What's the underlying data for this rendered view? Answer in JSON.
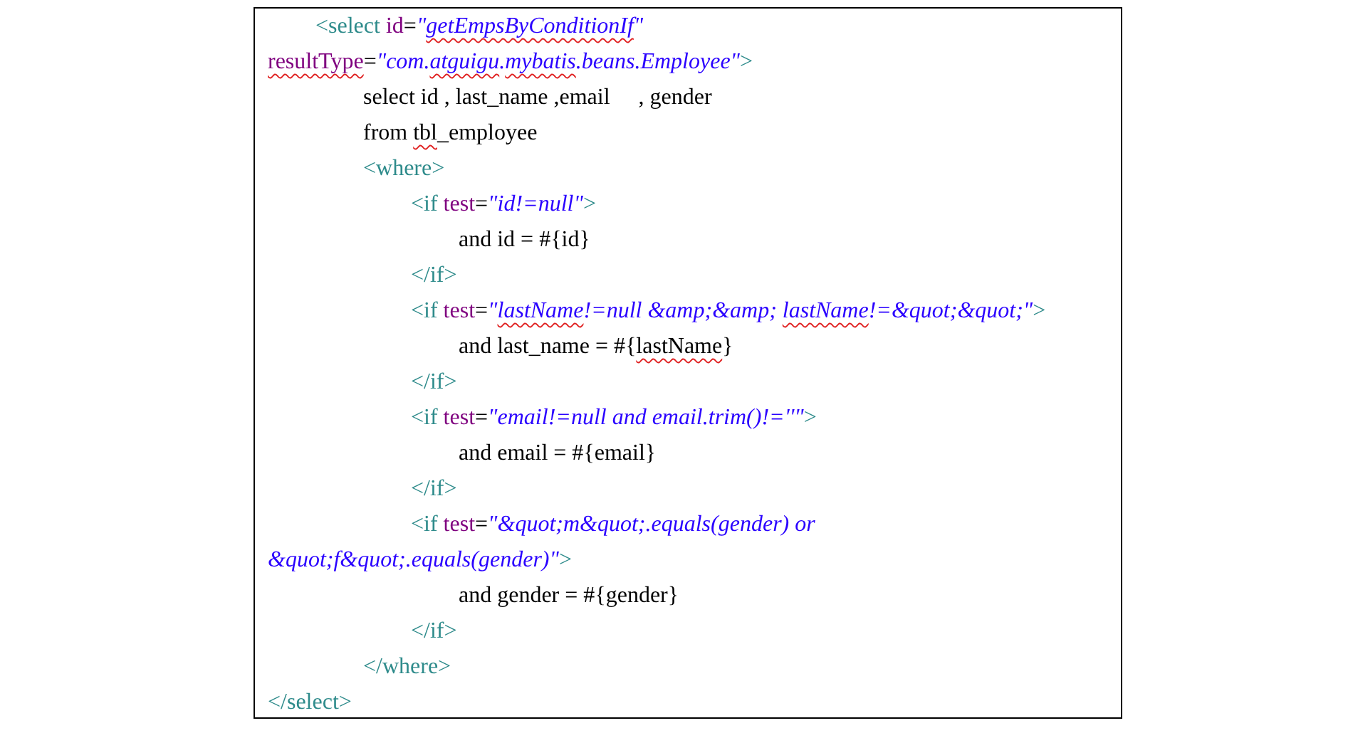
{
  "code_lines": [
    {
      "segments": [
        {
          "kind": "tag",
          "text": "\t<select "
        },
        {
          "kind": "attr",
          "text": "id"
        },
        {
          "kind": "plain",
          "text": "="
        },
        {
          "kind": "value",
          "text": "\""
        },
        {
          "kind": "value",
          "text": "getEmpsByConditionIf",
          "misspelled": true
        },
        {
          "kind": "value",
          "text": "\""
        }
      ]
    },
    {
      "segments": [
        {
          "kind": "attr",
          "text": "resultType",
          "misspelled": true
        },
        {
          "kind": "plain",
          "text": "="
        },
        {
          "kind": "value",
          "text": "\"com."
        },
        {
          "kind": "value",
          "text": "atguigu",
          "misspelled": true
        },
        {
          "kind": "value",
          "text": "."
        },
        {
          "kind": "value",
          "text": "mybatis",
          "misspelled": true
        },
        {
          "kind": "value",
          "text": ".beans.Employee\""
        },
        {
          "kind": "tag",
          "text": ">"
        }
      ]
    },
    {
      "segments": [
        {
          "kind": "plain",
          "text": "\t\tselect id , last_name ,email     , gender"
        }
      ]
    },
    {
      "segments": [
        {
          "kind": "plain",
          "text": "\t\tfrom "
        },
        {
          "kind": "plain",
          "text": "tbl",
          "misspelled": true
        },
        {
          "kind": "plain",
          "text": "_employee"
        }
      ]
    },
    {
      "segments": [
        {
          "kind": "tag",
          "text": "\t\t<where>"
        }
      ]
    },
    {
      "segments": [
        {
          "kind": "tag",
          "text": "\t\t\t<if "
        },
        {
          "kind": "attr",
          "text": "test"
        },
        {
          "kind": "plain",
          "text": "="
        },
        {
          "kind": "value",
          "text": "\"id!=null\""
        },
        {
          "kind": "tag",
          "text": ">"
        }
      ]
    },
    {
      "segments": [
        {
          "kind": "plain",
          "text": "\t\t\t\tand id = #{id}"
        }
      ]
    },
    {
      "segments": [
        {
          "kind": "tag",
          "text": "\t\t\t</if>"
        }
      ]
    },
    {
      "segments": [
        {
          "kind": "tag",
          "text": "\t\t\t<if "
        },
        {
          "kind": "attr",
          "text": "test"
        },
        {
          "kind": "plain",
          "text": "="
        },
        {
          "kind": "value",
          "text": "\""
        },
        {
          "kind": "value",
          "text": "lastName",
          "misspelled": true
        },
        {
          "kind": "value",
          "text": "!=null &amp;&amp; "
        },
        {
          "kind": "value",
          "text": "lastName",
          "misspelled": true
        },
        {
          "kind": "value",
          "text": "!=&quot;&quot;\""
        },
        {
          "kind": "tag",
          "text": ">"
        }
      ]
    },
    {
      "segments": [
        {
          "kind": "plain",
          "text": "\t\t\t\tand last_name = #{"
        },
        {
          "kind": "plain",
          "text": "lastName",
          "misspelled": true
        },
        {
          "kind": "plain",
          "text": "}"
        }
      ]
    },
    {
      "segments": [
        {
          "kind": "tag",
          "text": "\t\t\t</if>"
        }
      ]
    },
    {
      "segments": [
        {
          "kind": "tag",
          "text": "\t\t\t<if "
        },
        {
          "kind": "attr",
          "text": "test"
        },
        {
          "kind": "plain",
          "text": "="
        },
        {
          "kind": "value",
          "text": "\"email!=null and email.trim()!=''\""
        },
        {
          "kind": "tag",
          "text": ">"
        }
      ]
    },
    {
      "segments": [
        {
          "kind": "plain",
          "text": "\t\t\t\tand email = #{email}"
        }
      ]
    },
    {
      "segments": [
        {
          "kind": "tag",
          "text": "\t\t\t</if>"
        }
      ]
    },
    {
      "segments": [
        {
          "kind": "tag",
          "text": "\t\t\t<if "
        },
        {
          "kind": "attr",
          "text": "test"
        },
        {
          "kind": "plain",
          "text": "="
        },
        {
          "kind": "value",
          "text": "\"&quot;m&quot;.equals(gender) or"
        }
      ]
    },
    {
      "segments": [
        {
          "kind": "value",
          "text": "&quot;f&quot;.equals(gender)\""
        },
        {
          "kind": "tag",
          "text": ">"
        }
      ]
    },
    {
      "segments": [
        {
          "kind": "plain",
          "text": "\t\t\t\tand gender = #{gender}"
        }
      ]
    },
    {
      "segments": [
        {
          "kind": "tag",
          "text": "\t\t\t</if>"
        }
      ]
    },
    {
      "segments": [
        {
          "kind": "tag",
          "text": "\t\t</where>"
        }
      ]
    },
    {
      "segments": [
        {
          "kind": "tag",
          "text": "</select>"
        }
      ]
    }
  ]
}
